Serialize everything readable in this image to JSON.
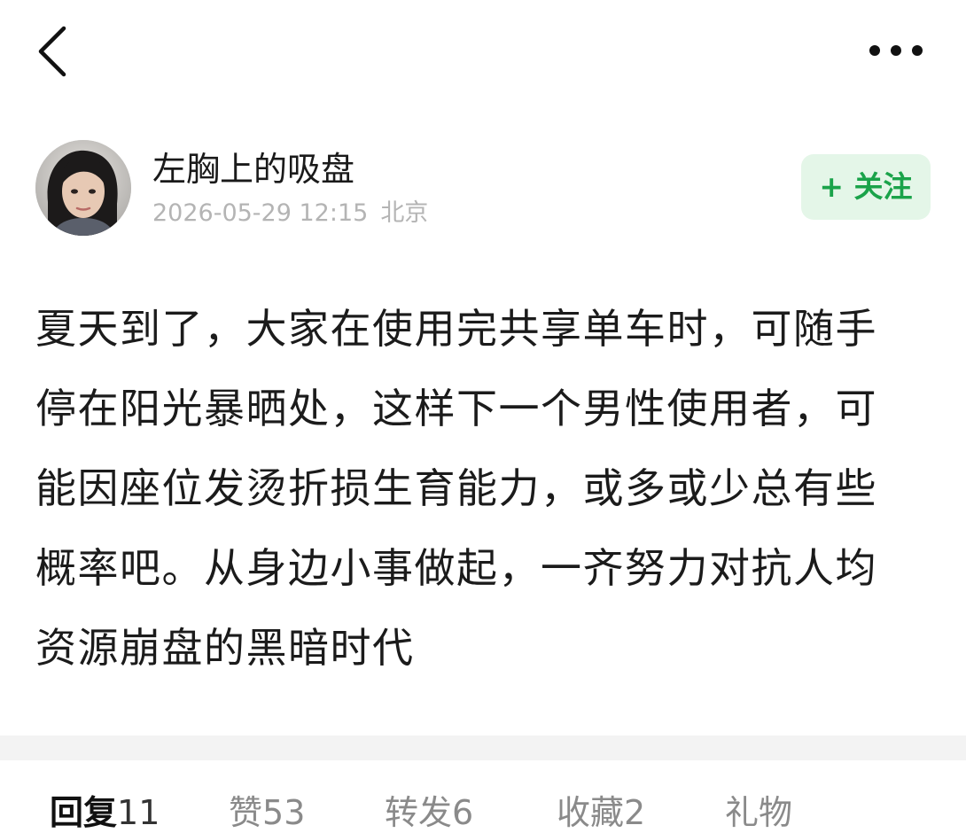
{
  "header": {
    "back_icon": "chevron-left-icon",
    "more_icon": "more-horizontal-icon"
  },
  "author": {
    "name": "左胸上的吸盘",
    "date": "2026-05-29 12:15",
    "location": "北京",
    "follow_label": "+ 关注",
    "follow_color": "#1aa34a",
    "follow_bg": "#e4f6e8"
  },
  "post": {
    "lines": [
      "夏天到了，大家在使用完共享单车时，可随手",
      "停在阳光暴晒处，这样下一个男性使用者，可",
      "能因座位发烫折损生育能力，或多或少总有些",
      "概率吧。从身边小事做起，一齐努力对抗人均",
      "资源崩盘的黑暗时代"
    ]
  },
  "tabs": [
    {
      "label": "回复",
      "count": "11",
      "active": true
    },
    {
      "label": "赞",
      "count": "53",
      "active": false
    },
    {
      "label": "转发",
      "count": "6",
      "active": false
    },
    {
      "label": "收藏",
      "count": "2",
      "active": false
    },
    {
      "label": "礼物",
      "count": "",
      "active": false
    }
  ]
}
